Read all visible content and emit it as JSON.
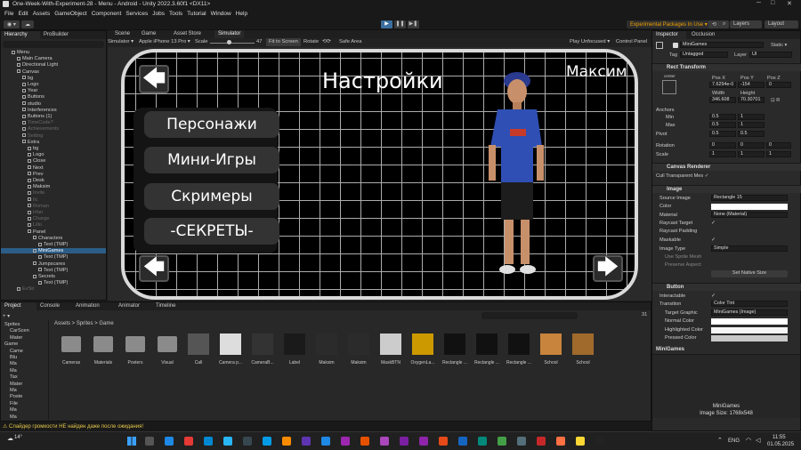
{
  "window": {
    "title": "One-Week-With-Experiment-28 - Menu - Android - Unity 2022.3.60f1 <DX11>"
  },
  "menu": [
    "File",
    "Edit",
    "Assets",
    "GameObject",
    "Component",
    "Services",
    "Jobs",
    "Tools",
    "Tutorial",
    "Window",
    "Help"
  ],
  "toolbar": {
    "packages": "Experimental Packages In Use ▾",
    "layers": "Layers",
    "layout": "Layout"
  },
  "hierarchy": {
    "tabs": [
      "Hierarchy",
      "ProBuilder"
    ],
    "items": [
      {
        "label": "Menu",
        "indent": 1,
        "dim": false
      },
      {
        "label": "Main Camera",
        "indent": 2,
        "dim": false
      },
      {
        "label": "Directional Light",
        "indent": 2,
        "dim": false
      },
      {
        "label": "Canvas",
        "indent": 2,
        "dim": false
      },
      {
        "label": "bg",
        "indent": 3,
        "dim": false
      },
      {
        "label": "Logo",
        "indent": 3,
        "dim": false
      },
      {
        "label": "Year",
        "indent": 3,
        "dim": false
      },
      {
        "label": "Buttons",
        "indent": 3,
        "dim": false
      },
      {
        "label": "studio",
        "indent": 3,
        "dim": false
      },
      {
        "label": "Interferences",
        "indent": 3,
        "dim": false
      },
      {
        "label": "Buttons (1)",
        "indent": 3,
        "dim": false
      },
      {
        "label": "TimeCode?",
        "indent": 3,
        "dim": true
      },
      {
        "label": "Achievements",
        "indent": 3,
        "dim": true
      },
      {
        "label": "Setting",
        "indent": 3,
        "dim": true
      },
      {
        "label": "Extra",
        "indent": 3,
        "dim": false
      },
      {
        "label": "bg",
        "indent": 4,
        "dim": false
      },
      {
        "label": "Logo",
        "indent": 4,
        "dim": false
      },
      {
        "label": "Close",
        "indent": 4,
        "dim": false
      },
      {
        "label": "Next",
        "indent": 4,
        "dim": false
      },
      {
        "label": "Prev",
        "indent": 4,
        "dim": false
      },
      {
        "label": "Desk",
        "indent": 4,
        "dim": false
      },
      {
        "label": "Maksim",
        "indent": 4,
        "dim": false
      },
      {
        "label": "Invite",
        "indent": 4,
        "dim": true
      },
      {
        "label": "Ilc",
        "indent": 4,
        "dim": true
      },
      {
        "label": "Roman",
        "indent": 4,
        "dim": true
      },
      {
        "label": "Irfan",
        "indent": 4,
        "dim": true
      },
      {
        "label": "Charge",
        "indent": 4,
        "dim": true
      },
      {
        "label": "Lillo",
        "indent": 4,
        "dim": true
      },
      {
        "label": "Panel",
        "indent": 4,
        "dim": false
      },
      {
        "label": "Characters",
        "indent": 5,
        "dim": false
      },
      {
        "label": "Text (TMP)",
        "indent": 6,
        "dim": false
      },
      {
        "label": "MiniGames",
        "indent": 5,
        "dim": false,
        "selected": true
      },
      {
        "label": "Text (TMP)",
        "indent": 6,
        "dim": false
      },
      {
        "label": "Jumpscares",
        "indent": 5,
        "dim": false
      },
      {
        "label": "Text (TMP)",
        "indent": 6,
        "dim": false
      },
      {
        "label": "Secrets",
        "indent": 5,
        "dim": false
      },
      {
        "label": "Text (TMP)",
        "indent": 6,
        "dim": false
      },
      {
        "label": "EvStr",
        "indent": 2,
        "dim": true
      }
    ]
  },
  "scene": {
    "tabs": [
      "Scene",
      "Game",
      "Asset Store",
      "Simulator"
    ],
    "sim": {
      "mode": "Simulator ▾",
      "device": "Apple iPhone 13 Pro ▾",
      "scale_label": "Scale",
      "scale_value": "47",
      "fit": "Fit to Screen",
      "rotate": "Rotate",
      "safe": "Safe Area",
      "play": "Play Unfocused ▾",
      "control": "Control Panel"
    }
  },
  "game": {
    "title": "Настройки",
    "name": "Максим",
    "buttons": [
      "Персонажи",
      "Мини-Игры",
      "Скримеры",
      "-СЕКРЕТЫ-"
    ]
  },
  "inspector": {
    "tabs": [
      "Inspector",
      "Occlusion"
    ],
    "object": "MiniGames",
    "static": "Static ▾",
    "tag_label": "Tag",
    "tag": "Untagged",
    "layer_label": "Layer",
    "layer": "UI",
    "rect": {
      "title": "Rect Transform",
      "anchor": "center",
      "pos_x_label": "Pos X",
      "pos_y_label": "Pos Y",
      "pos_z_label": "Pos Z",
      "pos_x": "7.6294e-0",
      "pos_y": "-154",
      "pos_z": "0",
      "width_label": "Width",
      "height_label": "Height",
      "width": "346.608",
      "height": "70.30701",
      "anchors": "Anchors",
      "min": "Min",
      "max": "Max",
      "min_x": "0.5",
      "min_y": "1",
      "max_x": "0.5",
      "max_y": "1",
      "pivot": "Pivot",
      "pivot_x": "0.5",
      "pivot_y": "0.5",
      "rotation": "Rotation",
      "rot_x": "0",
      "rot_y": "0",
      "rot_z": "0",
      "scale": "Scale",
      "sc_x": "1",
      "sc_y": "1",
      "sc_z": "1"
    },
    "canvas_renderer": {
      "title": "Canvas Renderer",
      "cull": "Cull Transparent Mes ✓"
    },
    "image": {
      "title": "Image",
      "source_label": "Source Image",
      "source": "Rectangle 15",
      "color_label": "Color",
      "material_label": "Material",
      "material": "None (Material)",
      "raycast_label": "Raycast Target",
      "padding_label": "Raycast Padding",
      "maskable_label": "Maskable",
      "type_label": "Image Type",
      "type": "Simple",
      "sprite_mesh": "Use Sprite Mesh",
      "preserve": "Preserve Aspect",
      "native": "Set Native Size"
    },
    "button": {
      "title": "Button",
      "interactable": "Interactable",
      "transition_label": "Transition",
      "transition": "Color Tint",
      "target_label": "Target Graphic",
      "target": "MiniGames (Image)",
      "normal": "Normal Color",
      "highlighted": "Highlighted Color",
      "pressed": "Pressed Color"
    },
    "footer_title": "MiniGames",
    "preview_name": "MiniGames",
    "preview_size": "Image Size: 1768x548"
  },
  "project": {
    "tabs": [
      "Project",
      "Console",
      "Animation",
      "Animator",
      "Timeline"
    ],
    "breadcrumb": "Assets > Sprites > Game",
    "count": "31",
    "tree": [
      "Sprites",
      "CarScen",
      "Mater",
      "Game",
      "Came",
      "Blu",
      "Ma",
      "Ma",
      "Tax",
      "Mater",
      "Ma",
      "Poste",
      "File",
      "Ma",
      "Ma"
    ],
    "assets": [
      "Cameras",
      "Materials",
      "Posters",
      "Visual",
      "Call",
      "Camera p...",
      "CameraB...",
      "Label",
      "Maksim",
      "Maksim",
      "MaskBTN",
      "OxygenLa...",
      "Rectangle ...",
      "Rectangle ...",
      "Rectangle ...",
      "School",
      "School"
    ]
  },
  "status": "⚠ Слайдер громкости НЕ найден даже после ожидания!",
  "taskbar": {
    "temp": "14°",
    "lang": "ENG",
    "time": "11:55",
    "date": "01.05.2025"
  }
}
